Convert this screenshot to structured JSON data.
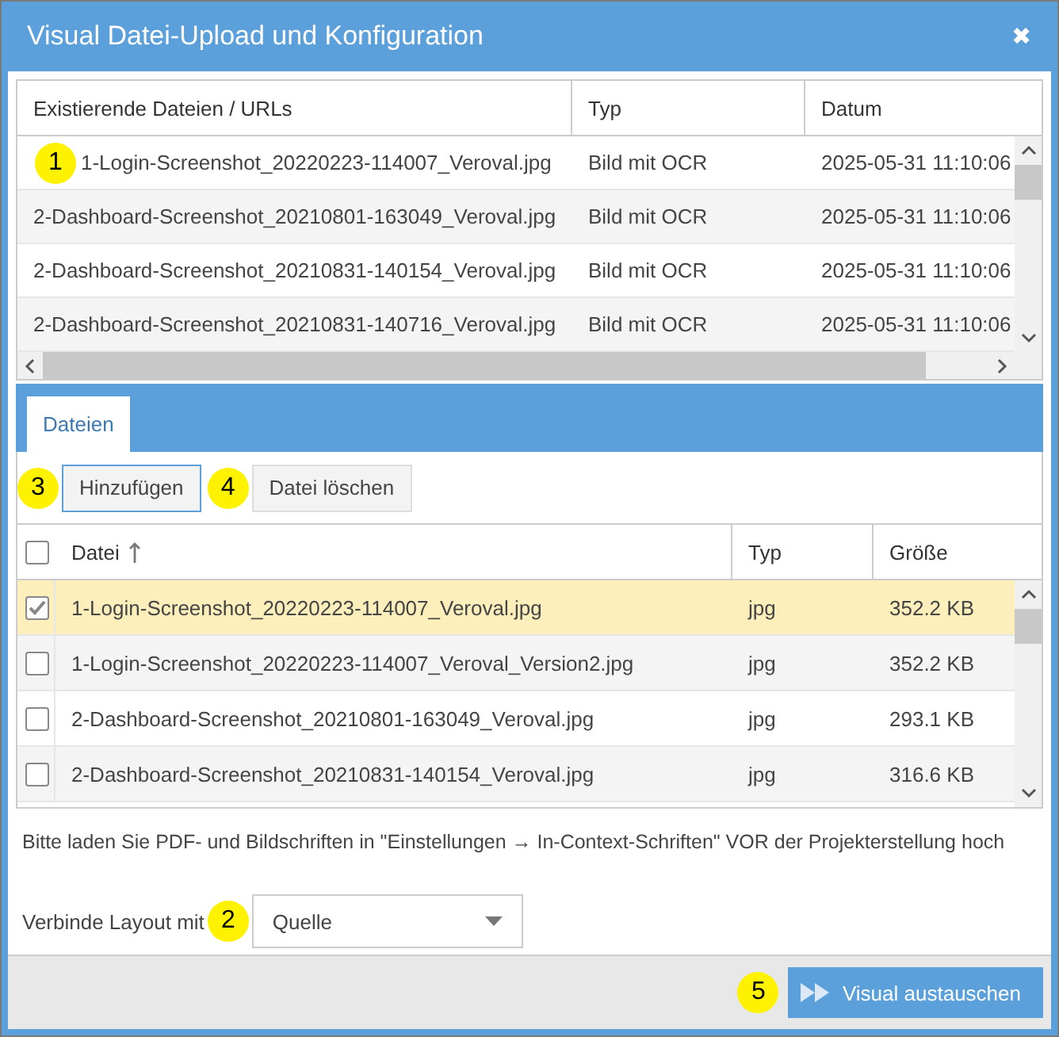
{
  "window": {
    "title": "Visual Datei-Upload und Konfiguration",
    "close": "✖"
  },
  "sources": {
    "columns": [
      "Existierende Dateien / URLs",
      "Typ",
      "Datum"
    ],
    "rows": [
      {
        "name": "1-Login-Screenshot_20220223-114007_Veroval.jpg",
        "type": "Bild mit OCR",
        "date": "2025-05-31 11:10:06",
        "callout": "1"
      },
      {
        "name": "2-Dashboard-Screenshot_20210801-163049_Veroval.jpg",
        "type": "Bild mit OCR",
        "date": "2025-05-31 11:10:06"
      },
      {
        "name": "2-Dashboard-Screenshot_20210831-140154_Veroval.jpg",
        "type": "Bild mit OCR",
        "date": "2025-05-31 11:10:06"
      },
      {
        "name": "2-Dashboard-Screenshot_20210831-140716_Veroval.jpg",
        "type": "Bild mit OCR",
        "date": "2025-05-31 11:10:06"
      }
    ]
  },
  "tabs": [
    {
      "label": "Dateien",
      "selected": true
    }
  ],
  "toolbar": [
    {
      "label": "Hinzufügen",
      "focused": true,
      "callout": "3"
    },
    {
      "label": "Datei löschen",
      "focused": false,
      "callout": "4"
    }
  ],
  "files": {
    "columns": [
      "Datei",
      "Typ",
      "Größe"
    ],
    "sort_ascending": true,
    "all_checked": false,
    "rows": [
      {
        "name": "1-Login-Screenshot_20220223-114007_Veroval.jpg",
        "type": "jpg",
        "size": "352.2 KB",
        "checked": true,
        "selected": true
      },
      {
        "name": "1-Login-Screenshot_20220223-114007_Veroval_Version2.jpg",
        "type": "jpg",
        "size": "352.2 KB",
        "checked": false,
        "selected": false
      },
      {
        "name": "2-Dashboard-Screenshot_20210801-163049_Veroval.jpg",
        "type": "jpg",
        "size": "293.1 KB",
        "checked": false,
        "selected": false
      },
      {
        "name": "2-Dashboard-Screenshot_20210831-140154_Veroval.jpg",
        "type": "jpg",
        "size": "316.6 KB",
        "checked": false,
        "selected": false
      }
    ]
  },
  "hint": "Bitte laden Sie PDF- und Bildschriften in \"Einstellungen → In-Context-Schriften\" VOR der Projekterstellung hoch",
  "layout_select": {
    "label": "Verbinde Layout mit",
    "value": "Quelle",
    "callout": "2"
  },
  "submit": {
    "label": "Visual austauschen",
    "callout": "5"
  }
}
